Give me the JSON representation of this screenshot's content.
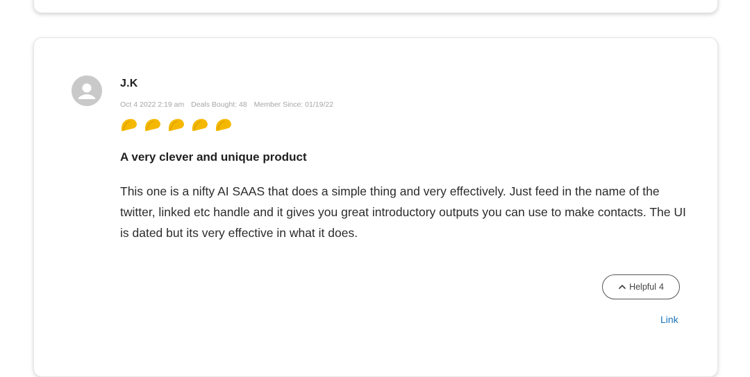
{
  "review": {
    "author": "J.K",
    "date": "Oct 4 2022 2:19 am",
    "deals_bought": "Deals Bought: 48",
    "member_since": "Member Since: 01/19/22",
    "rating": 5,
    "rating_icon": "taco-icon",
    "title": "A very clever and unique product",
    "body": "This one is a nifty AI SAAS that does a simple thing and very effectively. Just feed in the name of the twitter, linked etc handle and it gives you great introductory outputs you can use to make contacts. The UI is dated but its very effective in what it does.",
    "helpful_label": "Helpful",
    "helpful_count": "4",
    "link_label": "Link"
  },
  "colors": {
    "taco": "#f5b800",
    "link": "#1a73b8",
    "avatar": "#c9c9c9"
  }
}
